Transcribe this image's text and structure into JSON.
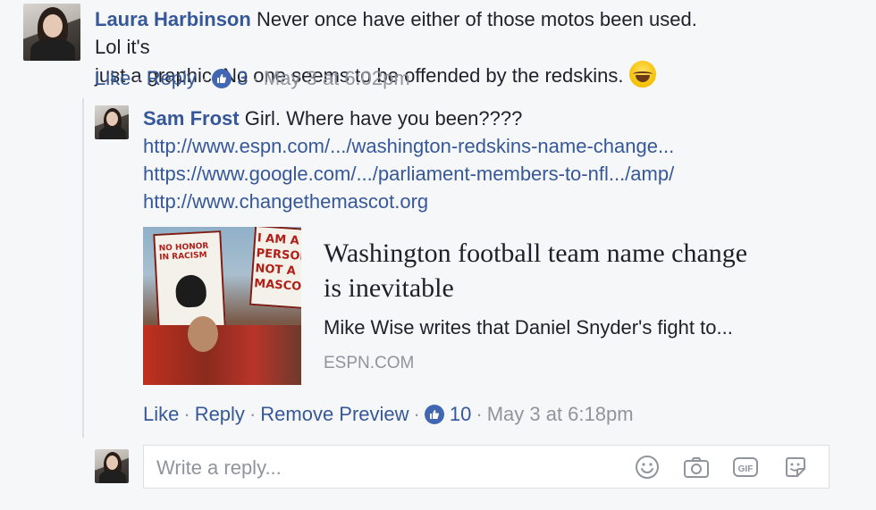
{
  "comment": {
    "author": "Laura Harbinson",
    "text_line1": "Never once have either of those motos been used. Lol it's",
    "text_line2": "just a graphic. No one seems to be offended by the redskins.",
    "actions": {
      "like": "Like",
      "reply": "Reply",
      "like_count": "3",
      "timestamp": "May 3 at 6:02pm"
    }
  },
  "reply": {
    "author": "Sam Frost",
    "text": "Girl. Where have you been????",
    "links": [
      "http://www.espn.com/.../washington-redskins-name-change...",
      "https://www.google.com/.../parliament-members-to-nfl.../amp/",
      "http://www.changethemascot.org"
    ],
    "preview": {
      "title": "Washington football team name change is inevitable",
      "description": "Mike Wise writes that Daniel Snyder's fight to...",
      "source": "ESPN.COM",
      "image_sign_text_1": "NO HONOR IN RACISM",
      "image_sign_text_2": "I AM A PERSON NOT A MASCOT"
    },
    "actions": {
      "like": "Like",
      "reply": "Reply",
      "remove_preview": "Remove Preview",
      "like_count": "10",
      "timestamp": "May 3 at 6:18pm"
    }
  },
  "composer": {
    "placeholder": "Write a reply...",
    "icons": [
      "emoji-icon",
      "camera-icon",
      "gif-icon",
      "sticker-icon"
    ]
  },
  "colors": {
    "link": "#365899",
    "meta": "#90949c",
    "like_blue": "#4267b2",
    "background": "#f6f7f9"
  }
}
